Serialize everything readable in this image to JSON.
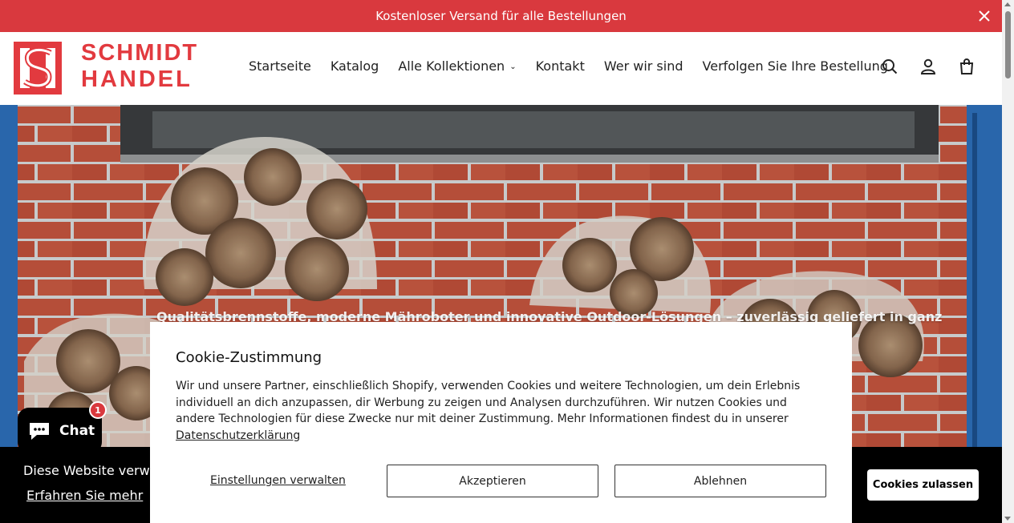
{
  "announcement": {
    "text": "Kostenloser Versand für alle Bestellungen",
    "close_icon": "close-icon"
  },
  "brand": {
    "line1": "SCHMIDT",
    "line2": "HANDEL",
    "color": "#e23a3f"
  },
  "nav": {
    "items": [
      {
        "label": "Startseite"
      },
      {
        "label": "Katalog"
      },
      {
        "label": "Alle Kollektionen"
      },
      {
        "label": "Kontakt"
      },
      {
        "label": "Wer wir sind"
      },
      {
        "label": "Verfolgen Sie Ihre Bestellung"
      }
    ]
  },
  "header_icons": [
    "search-icon",
    "account-icon",
    "cart-icon"
  ],
  "hero": {
    "tagline": "Qualitätsbrennstoffe, moderne Mähroboter und innovative Outdoor-Lösungen – zuverlässig geliefert in ganz"
  },
  "consent": {
    "title": "Cookie-Zustimmung",
    "body": "Wir und unsere Partner, einschließlich Shopify, verwenden Cookies und weitere Technologien, um dein Erlebnis individuell an dich anzupassen, dir Werbung zu zeigen und Analysen durchzuführen. Wir nutzen Cookies und andere Technologien für diese Zwecke nur mit deiner Zustimmung. Mehr Informationen findest du in unserer",
    "privacy_link": "Datenschutzerklärung",
    "manage_label": "Einstellungen verwalten",
    "accept_label": "Akzeptieren",
    "decline_label": "Ablehnen"
  },
  "cookie_bar": {
    "message": "Diese Website verwe",
    "learn_more": "Erfahren Sie mehr",
    "allow_label": "Cookies zulassen"
  },
  "chat": {
    "label": "Chat",
    "badge": "1"
  },
  "colors": {
    "accent": "#d9393e",
    "dark": "#000000"
  }
}
